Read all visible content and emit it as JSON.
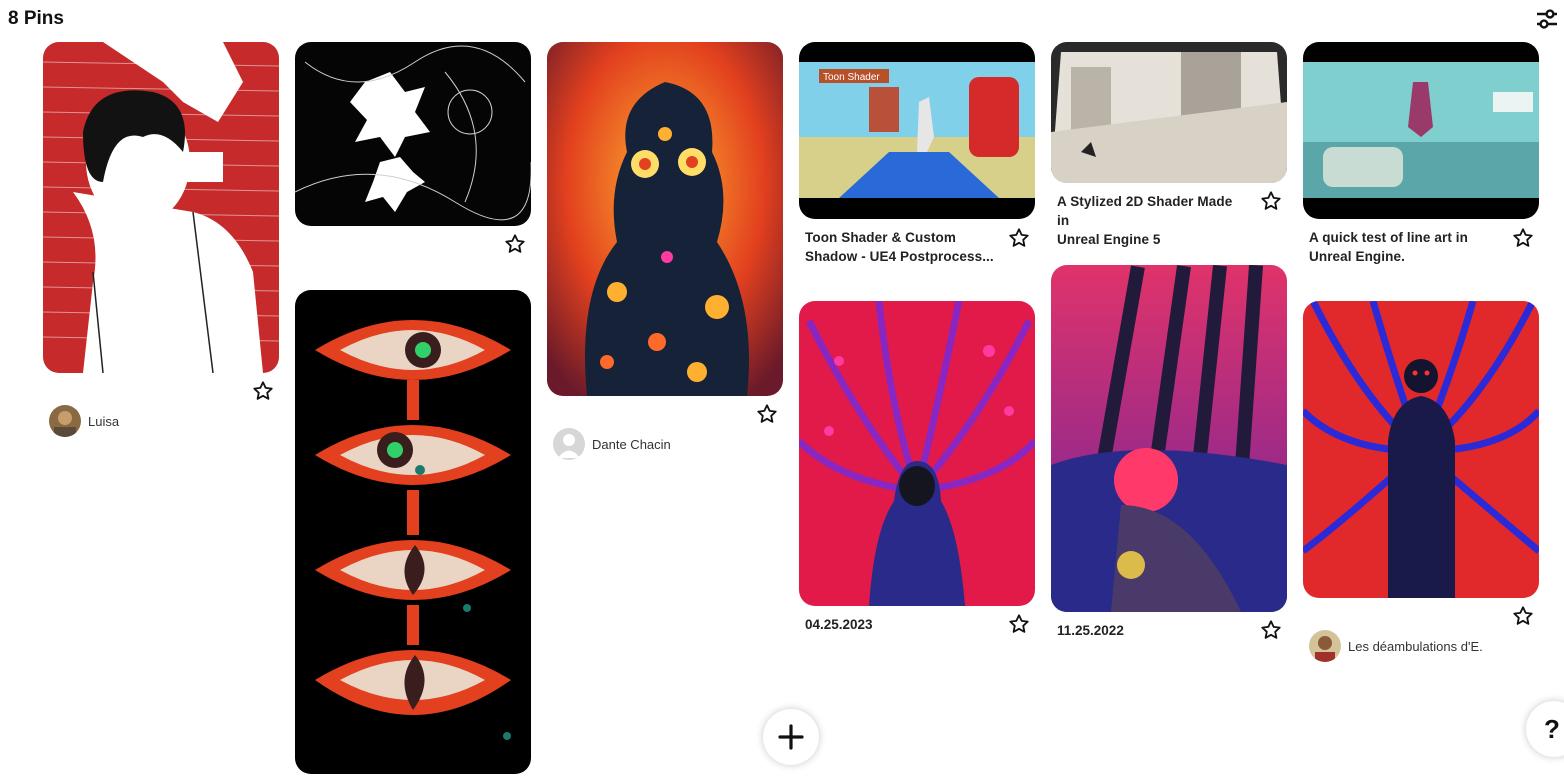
{
  "header": {
    "pins_count": "8 Pins",
    "filter_icon": "sliders-icon"
  },
  "pins": [
    {
      "id": "luisa",
      "creator": "Luisa"
    },
    {
      "id": "black-splash"
    },
    {
      "id": "eyes"
    },
    {
      "id": "fire-creature",
      "creator": "Dante Chacin"
    },
    {
      "id": "toon-shader",
      "badge": "Toon Shader",
      "title_line1": "Toon Shader & Custom",
      "title_line2": "Shadow - UE4 Postprocess..."
    },
    {
      "id": "stylized-2d",
      "title_line1": "A Stylized 2D Shader Made in",
      "title_line2": "Unreal Engine 5"
    },
    {
      "id": "line-art",
      "title_line1": "A quick test of line art in",
      "title_line2": "Unreal Engine."
    },
    {
      "id": "psychedelic-girl",
      "date": "04.25.2023"
    },
    {
      "id": "forest-figure",
      "date": "11.25.2022"
    },
    {
      "id": "red-blue-figure",
      "creator": "Les déambulations d'E."
    }
  ],
  "actions": {
    "add_icon": "plus-icon",
    "help_label": "?"
  },
  "colors": {
    "accent": "#111111",
    "background": "#ffffff"
  }
}
